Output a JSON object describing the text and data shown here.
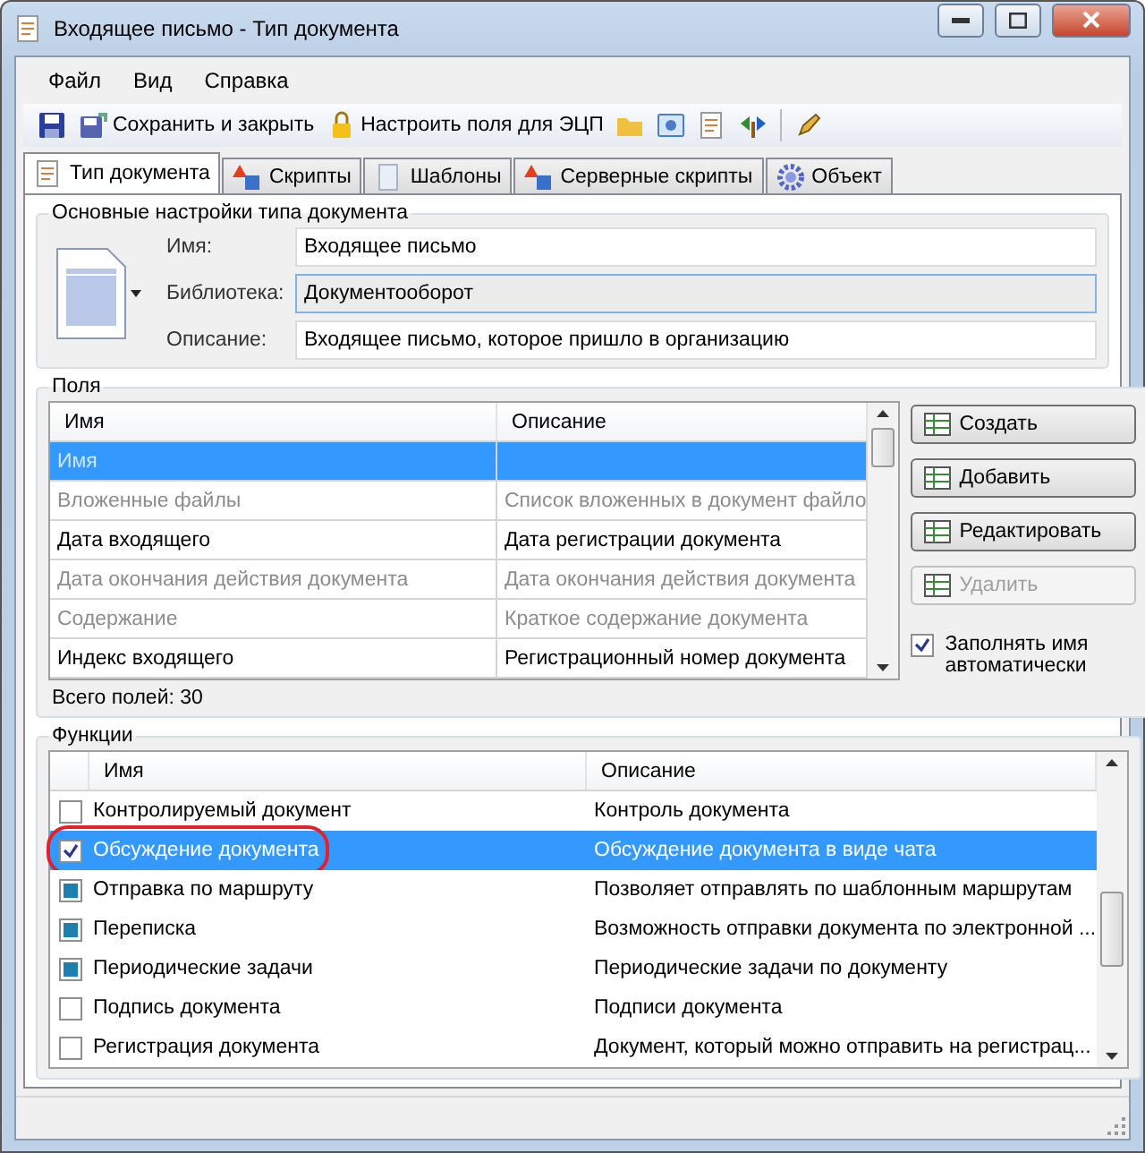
{
  "window": {
    "title": "Входящее письмо - Тип документа"
  },
  "menu": [
    "Файл",
    "Вид",
    "Справка"
  ],
  "toolbar": [
    {
      "kind": "save"
    },
    {
      "kind": "save-close",
      "label": "Сохранить и закрыть"
    },
    {
      "kind": "lock",
      "label": "Настроить поля для ЭЦП"
    },
    {
      "kind": "folder"
    },
    {
      "kind": "window"
    },
    {
      "kind": "doc"
    },
    {
      "kind": "arrows"
    },
    {
      "kind": "sep"
    },
    {
      "kind": "pencil"
    }
  ],
  "tabs": [
    {
      "label": "Тип документа",
      "kind": "doc",
      "selected": true
    },
    {
      "label": "Скрипты",
      "kind": "shapes",
      "selected": false
    },
    {
      "label": "Шаблоны",
      "kind": "page",
      "selected": false
    },
    {
      "label": "Серверные скрипты",
      "kind": "shapes",
      "selected": false
    },
    {
      "label": "Объект",
      "kind": "gear",
      "selected": false
    }
  ],
  "basic": {
    "title": "Основные настройки типа документа",
    "fields": [
      {
        "label": "Имя:",
        "value": "Входящее письмо",
        "readonly": false
      },
      {
        "label": "Библиотека:",
        "value": "Документооборот",
        "readonly": true
      },
      {
        "label": "Описание:",
        "value": "Входящее письмо, которое пришло в организацию",
        "readonly": false
      }
    ]
  },
  "fields": {
    "title": "Поля",
    "columns": [
      "Имя",
      "Описание"
    ],
    "rows": [
      {
        "name": "Имя",
        "dimmed": true,
        "selected": true
      },
      {
        "name": "Вложенные файлы",
        "description": "Список вложенных в документ файло",
        "dimmed": true,
        "selected": false
      },
      {
        "name": "Дата входящего",
        "description": "Дата регистрации документа",
        "dimmed": false,
        "selected": false
      },
      {
        "name": "Дата окончания действия документа",
        "description": "Дата окончания действия документа",
        "dimmed": true,
        "selected": false
      },
      {
        "name": "Содержание",
        "description": "Краткое содержание документа",
        "dimmed": true,
        "selected": false
      },
      {
        "name": "Индекс входящего",
        "description": "Регистрационный номер документа",
        "dimmed": false,
        "selected": false
      }
    ],
    "total": "Всего полей: 30",
    "buttons": [
      {
        "label": "Создать",
        "disabled": false
      },
      {
        "label": "Добавить",
        "disabled": false
      },
      {
        "label": "Редактировать",
        "disabled": false
      },
      {
        "label": "Удалить",
        "disabled": true
      }
    ],
    "autofill": {
      "label": "Заполнять имя автоматически",
      "checked": true
    }
  },
  "functions": {
    "title": "Функции",
    "columns": [
      "Имя",
      "Описание"
    ],
    "rows": [
      {
        "name": "Контролируемый документ",
        "description": "Контроль документа",
        "checked": false,
        "indeterminate": false,
        "selected": false,
        "highlighted": false
      },
      {
        "name": "Обсуждение документа",
        "description": "Обсуждение документа в виде чата",
        "checked": true,
        "indeterminate": false,
        "selected": true,
        "highlighted": true
      },
      {
        "name": "Отправка по маршруту",
        "description": "Позволяет отправлять по шаблонным маршрутам",
        "checked": false,
        "indeterminate": true,
        "selected": false,
        "highlighted": false
      },
      {
        "name": "Переписка",
        "description": "Возможность отправки документа по электронной ...",
        "checked": false,
        "indeterminate": true,
        "selected": false,
        "highlighted": false
      },
      {
        "name": "Периодические задачи",
        "description": "Периодические задачи по документу",
        "checked": false,
        "indeterminate": true,
        "selected": false,
        "highlighted": false
      },
      {
        "name": "Подпись документа",
        "description": "Подписи документа",
        "checked": false,
        "indeterminate": false,
        "selected": false,
        "highlighted": false
      },
      {
        "name": "Регистрация документа",
        "description": "Документ, который можно отправить на регистрац...",
        "checked": false,
        "indeterminate": false,
        "selected": false,
        "highlighted": false
      }
    ]
  }
}
